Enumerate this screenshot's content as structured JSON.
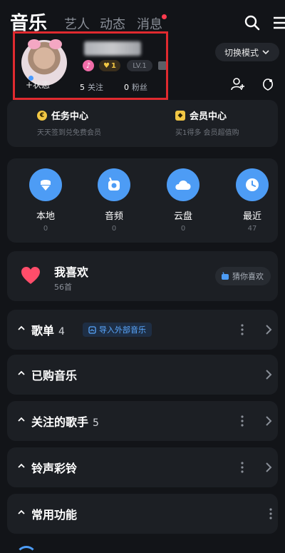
{
  "tabs": [
    {
      "label": "音乐",
      "active": true
    },
    {
      "label": "艺人",
      "active": false
    },
    {
      "label": "动态",
      "active": false
    },
    {
      "label": "消息",
      "active": false,
      "has_notification": true
    }
  ],
  "icons": {
    "search": "search-icon",
    "menu": "menu-icon"
  },
  "profile": {
    "status_label": "+状态",
    "badges": {
      "vip_level": "1",
      "lv": "LV.1"
    },
    "follow_count": "5",
    "follow_label": "关注",
    "fans_count": "0",
    "fans_label": "粉丝"
  },
  "mode_switch": {
    "label": "切换模式"
  },
  "task_center": {
    "left": {
      "title": "任务中心",
      "subtitle": "天天签到兑免费会员",
      "icon_char": "€"
    },
    "right": {
      "title": "会员中心",
      "subtitle": "买1得多 会员超值购"
    }
  },
  "shortcuts": [
    {
      "label": "本地",
      "count": "0",
      "icon": "local-music-icon"
    },
    {
      "label": "音频",
      "count": "0",
      "icon": "audio-icon"
    },
    {
      "label": "云盘",
      "count": "0",
      "icon": "cloud-disk-icon"
    },
    {
      "label": "最近",
      "count": "47",
      "icon": "recent-clock-icon"
    }
  ],
  "favorites": {
    "title": "我喜欢",
    "count_label": "56首",
    "guess_label": "猜你喜欢"
  },
  "sections": [
    {
      "title": "歌单",
      "count": "4",
      "import_label": "导入外部音乐"
    },
    {
      "title": "已购音乐",
      "count": ""
    },
    {
      "title": "关注的歌手",
      "count": "5"
    },
    {
      "title": "铃声彩铃",
      "count": ""
    },
    {
      "title": "常用功能",
      "count": ""
    }
  ],
  "colors": {
    "accent": "#4d9cf5",
    "background": "#121418",
    "card": "#1c1f24",
    "highlight_border": "#e02a2f",
    "heart": "#ff4d6a",
    "gold": "#f2c744"
  }
}
